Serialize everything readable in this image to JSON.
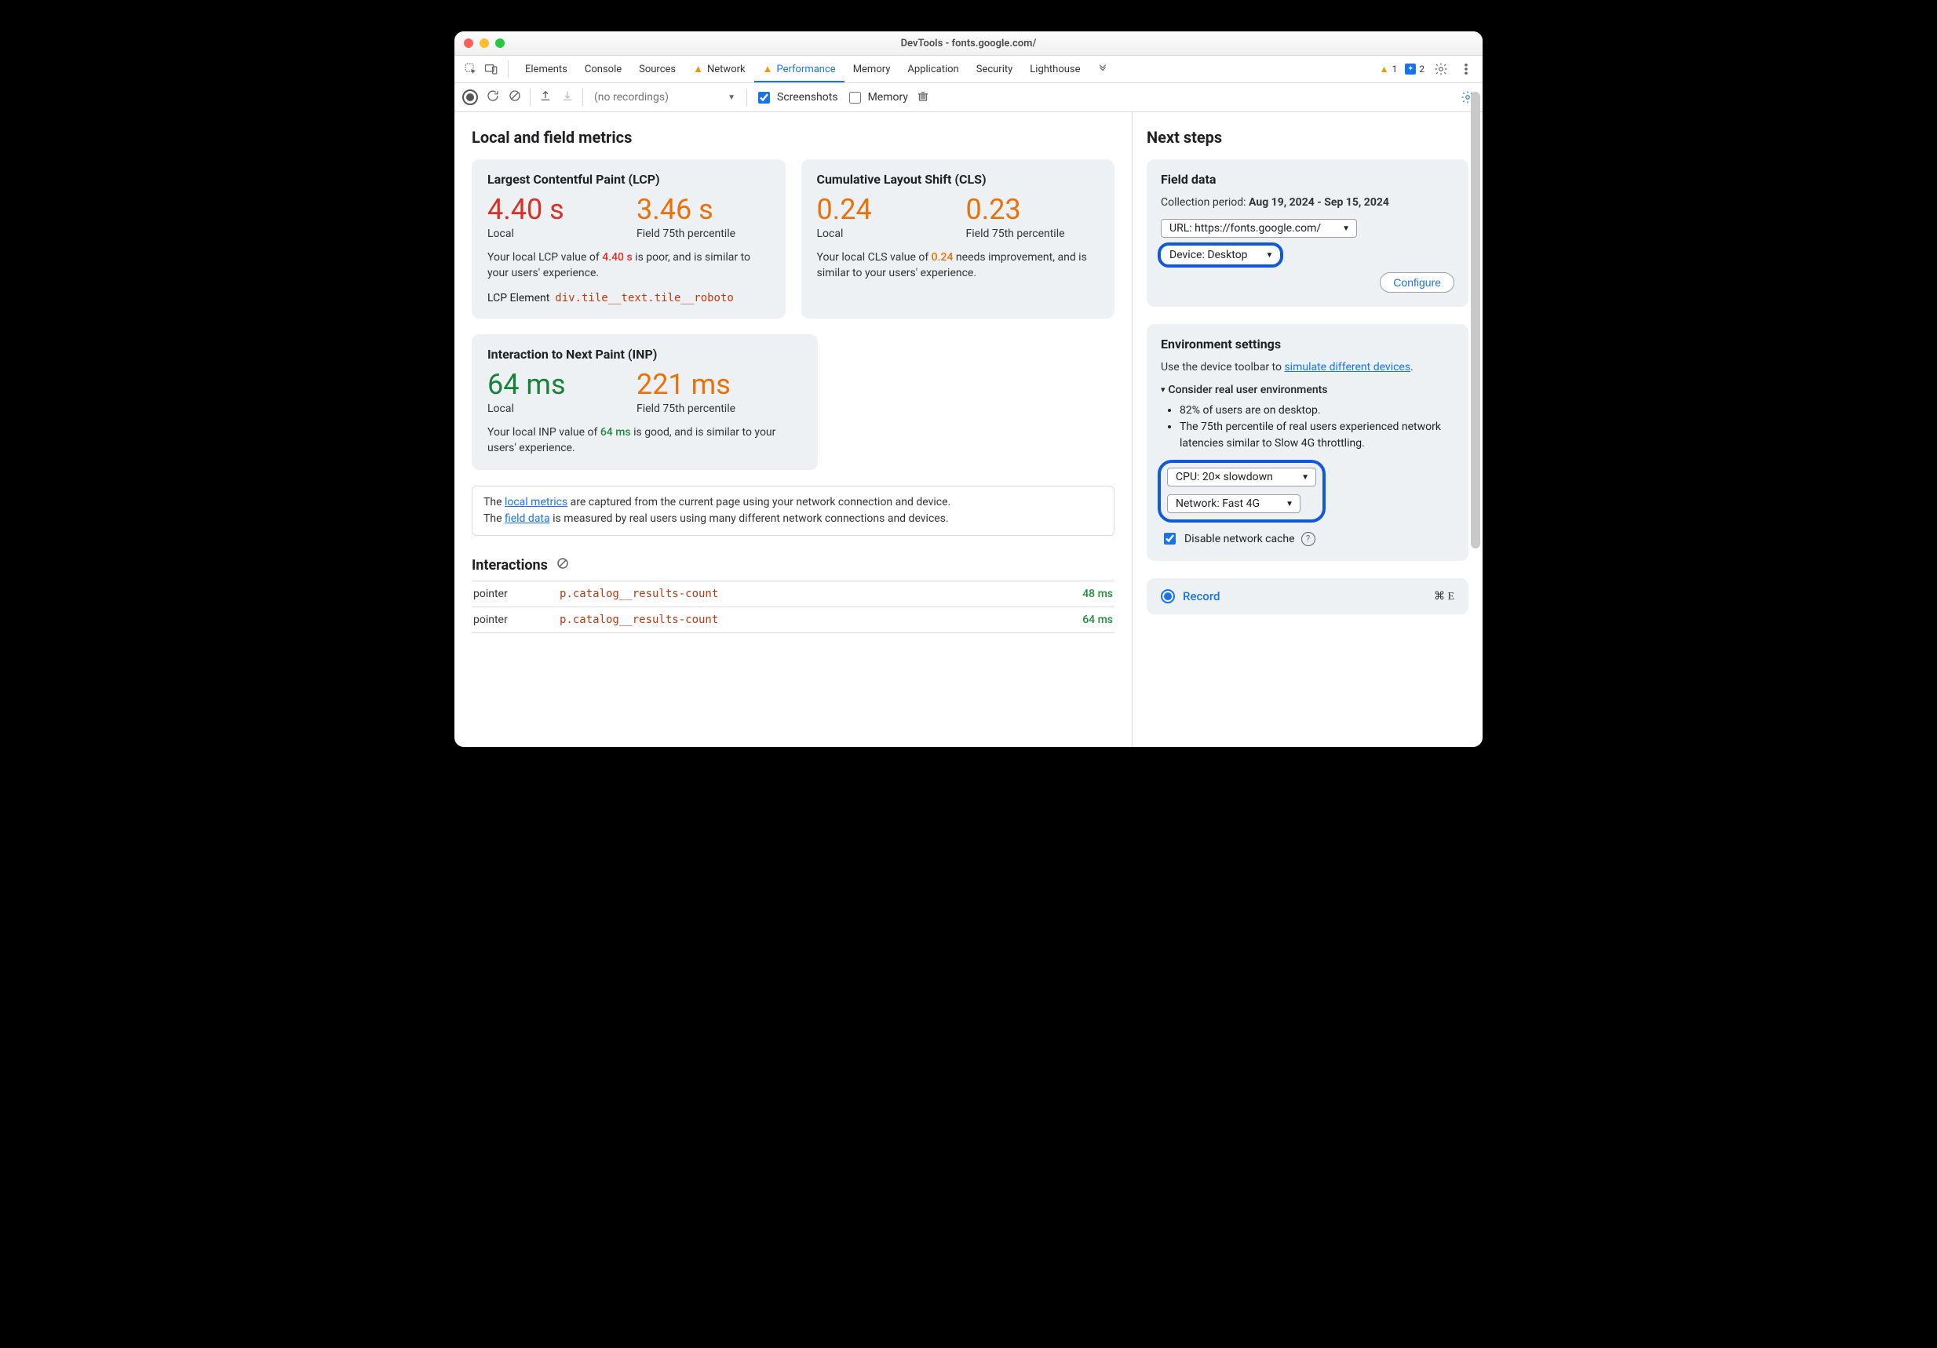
{
  "window": {
    "title": "DevTools - fonts.google.com/"
  },
  "tabs": {
    "list": [
      "Elements",
      "Console",
      "Sources",
      "Network",
      "Performance",
      "Memory",
      "Application",
      "Security",
      "Lighthouse"
    ],
    "warn_index": [
      3,
      4
    ],
    "active": "Performance",
    "warn_count": "1",
    "msg_count": "2"
  },
  "toolbar": {
    "recordings_placeholder": "(no recordings)",
    "screenshots_label": "Screenshots",
    "screenshots_checked": true,
    "memory_label": "Memory",
    "memory_checked": false
  },
  "metrics": {
    "title": "Local and field metrics",
    "lcp": {
      "heading": "Largest Contentful Paint (LCP)",
      "local_value": "4.40 s",
      "local_label": "Local",
      "field_value": "3.46 s",
      "field_label": "Field 75th percentile",
      "desc_pre": "Your local LCP value of ",
      "desc_val": "4.40 s",
      "desc_post": " is poor, and is similar to your users' experience.",
      "element_label": "LCP Element",
      "element_selector": "div.tile__text.tile__roboto"
    },
    "cls": {
      "heading": "Cumulative Layout Shift (CLS)",
      "local_value": "0.24",
      "local_label": "Local",
      "field_value": "0.23",
      "field_label": "Field 75th percentile",
      "desc_pre": "Your local CLS value of ",
      "desc_val": "0.24",
      "desc_post": " needs improvement, and is similar to your users' experience."
    },
    "inp": {
      "heading": "Interaction to Next Paint (INP)",
      "local_value": "64 ms",
      "local_label": "Local",
      "field_value": "221 ms",
      "field_label": "Field 75th percentile",
      "desc_pre": "Your local INP value of ",
      "desc_val": "64 ms",
      "desc_post": " is good, and is similar to your users' experience."
    },
    "note": {
      "l1a": "The ",
      "l1link": "local metrics",
      "l1b": " are captured from the current page using your network connection and device.",
      "l2a": "The ",
      "l2link": "field data",
      "l2b": " is measured by real users using many different network connections and devices."
    }
  },
  "interactions": {
    "title": "Interactions",
    "rows": [
      {
        "type": "pointer",
        "selector": "p.catalog__results-count",
        "ms": "48 ms"
      },
      {
        "type": "pointer",
        "selector": "p.catalog__results-count",
        "ms": "64 ms"
      }
    ]
  },
  "side": {
    "title": "Next steps",
    "field": {
      "heading": "Field data",
      "period_label": "Collection period: ",
      "period_value": "Aug 19, 2024 - Sep 15, 2024",
      "url_label": "URL: https://fonts.google.com/",
      "device_label": "Device: Desktop",
      "configure": "Configure"
    },
    "env": {
      "heading": "Environment settings",
      "hint_pre": "Use the device toolbar to ",
      "hint_link": "simulate different devices",
      "hint_post": ".",
      "summary": "Consider real user environments",
      "bullets": [
        "82% of users are on desktop.",
        "The 75th percentile of real users experienced network latencies similar to Slow 4G throttling."
      ],
      "cpu": "CPU: 20× slowdown",
      "net": "Network: Fast 4G",
      "disable_cache": "Disable network cache"
    },
    "record": {
      "label": "Record",
      "shortcut": "⌘ E"
    }
  }
}
